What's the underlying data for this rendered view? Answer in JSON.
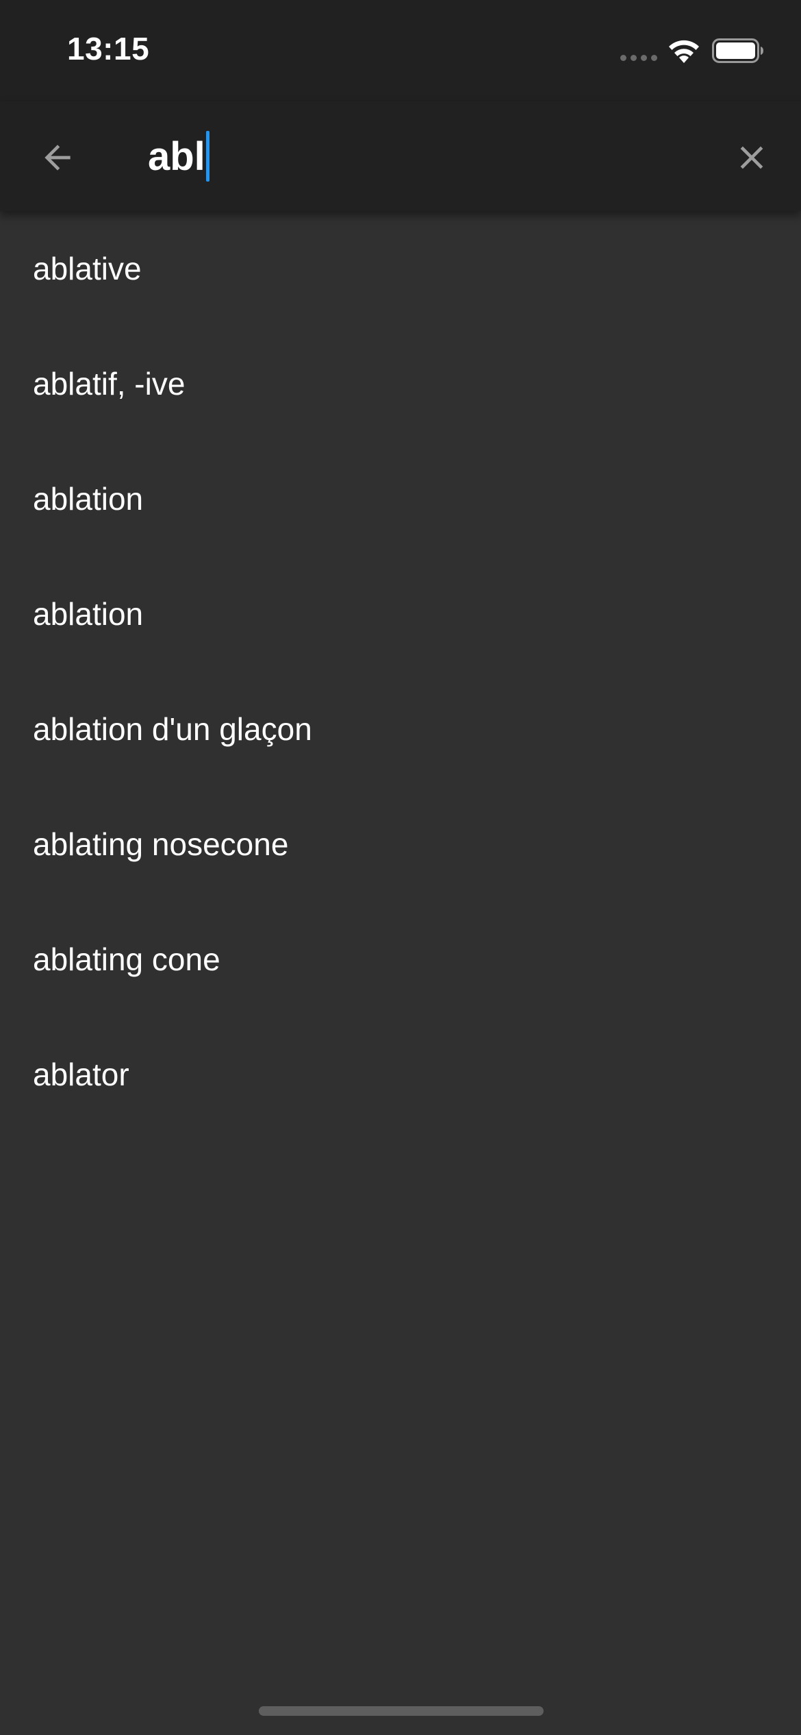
{
  "status_bar": {
    "time": "13:15",
    "icons": [
      "signal-dots-icon",
      "wifi-icon",
      "battery-icon"
    ]
  },
  "app_bar": {
    "back_icon": "arrow-left-icon",
    "search_value": "abl",
    "clear_icon": "close-icon",
    "caret_color": "#2196f3"
  },
  "results": [
    {
      "label": "ablative"
    },
    {
      "label": "ablatif, -ive"
    },
    {
      "label": "ablation"
    },
    {
      "label": "ablation"
    },
    {
      "label": "ablation d'un glaçon"
    },
    {
      "label": "ablating nosecone"
    },
    {
      "label": "ablating cone"
    },
    {
      "label": "ablator"
    }
  ],
  "colors": {
    "background": "#303030",
    "bar_background": "#212121",
    "text": "#ffffff",
    "icon_gray": "#9e9e9e"
  }
}
